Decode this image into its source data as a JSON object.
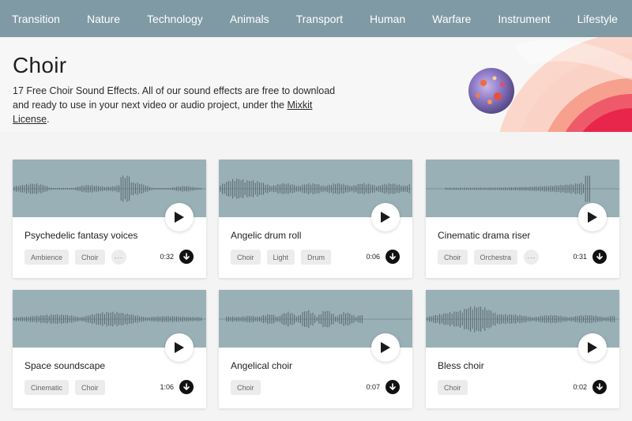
{
  "nav": {
    "items": [
      "Transition",
      "Nature",
      "Technology",
      "Animals",
      "Transport",
      "Human",
      "Warfare",
      "Instrument",
      "Lifestyle"
    ]
  },
  "hero": {
    "title": "Choir",
    "description": "17 Free Choir Sound Effects. All of our sound effects are free to download and ready to use in your next video or audio project, under the",
    "link_text": "Mixkit License",
    "suffix": "."
  },
  "colors": {
    "nav_bg": "#7f9aa5",
    "wave_bg": "#9ab0b7",
    "accent_red": "#e8254a",
    "accent_peach": "#f7a089"
  },
  "cards": [
    {
      "title": "Psychedelic fantasy voices",
      "tags": [
        "Ambience",
        "Choir"
      ],
      "more": true,
      "duration": "0:32"
    },
    {
      "title": "Angelic drum roll",
      "tags": [
        "Choir",
        "Light",
        "Drum"
      ],
      "more": false,
      "duration": "0:06"
    },
    {
      "title": "Cinematic drama riser",
      "tags": [
        "Choir",
        "Orchestra"
      ],
      "more": true,
      "duration": "0:31"
    },
    {
      "title": "Space soundscape",
      "tags": [
        "Cinematic",
        "Choir"
      ],
      "more": false,
      "duration": "1:06"
    },
    {
      "title": "Angelical choir",
      "tags": [
        "Choir"
      ],
      "more": false,
      "duration": "0:07"
    },
    {
      "title": "Bless choir",
      "tags": [
        "Choir"
      ],
      "more": false,
      "duration": "0:02"
    }
  ],
  "more_label": "···",
  "icons": {
    "play": "play-icon",
    "download": "download-icon",
    "more": "more-options-icon"
  }
}
